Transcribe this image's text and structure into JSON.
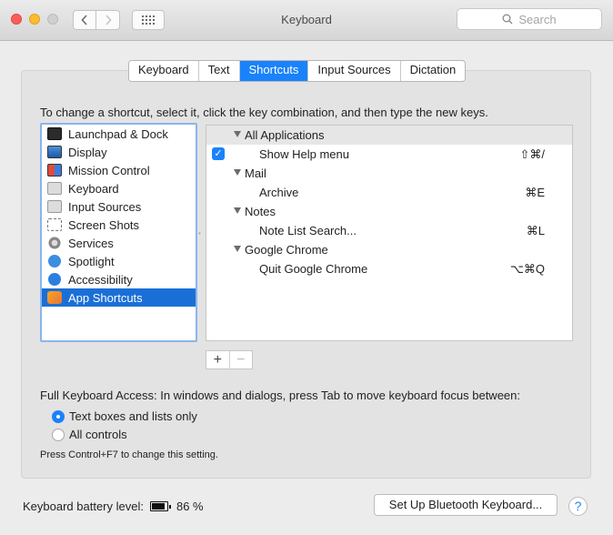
{
  "window": {
    "title": "Keyboard"
  },
  "search": {
    "placeholder": "Search"
  },
  "tabs": [
    {
      "label": "Keyboard",
      "active": false
    },
    {
      "label": "Text",
      "active": false
    },
    {
      "label": "Shortcuts",
      "active": true
    },
    {
      "label": "Input Sources",
      "active": false
    },
    {
      "label": "Dictation",
      "active": false
    }
  ],
  "instructions": "To change a shortcut, select it, click the key combination, and then type the new keys.",
  "categories": [
    {
      "label": "Launchpad & Dock",
      "icon": "launchpad-icon"
    },
    {
      "label": "Display",
      "icon": "display-icon"
    },
    {
      "label": "Mission Control",
      "icon": "mission-control-icon"
    },
    {
      "label": "Keyboard",
      "icon": "keyboard-icon"
    },
    {
      "label": "Input Sources",
      "icon": "input-sources-icon"
    },
    {
      "label": "Screen Shots",
      "icon": "screenshot-icon"
    },
    {
      "label": "Services",
      "icon": "gear-icon"
    },
    {
      "label": "Spotlight",
      "icon": "spotlight-icon"
    },
    {
      "label": "Accessibility",
      "icon": "accessibility-icon"
    },
    {
      "label": "App Shortcuts",
      "icon": "app-shortcuts-icon",
      "selected": true
    }
  ],
  "shortcuts": {
    "groups": [
      {
        "name": "All Applications",
        "items": [
          {
            "label": "Show Help menu",
            "keys": "⇧⌘/",
            "checked": true
          }
        ]
      },
      {
        "name": "Mail",
        "items": [
          {
            "label": "Archive",
            "keys": "⌘E"
          }
        ]
      },
      {
        "name": "Notes",
        "items": [
          {
            "label": "Note List Search...",
            "keys": "⌘L"
          }
        ]
      },
      {
        "name": "Google Chrome",
        "items": [
          {
            "label": "Quit Google Chrome",
            "keys": "⌥⌘Q"
          }
        ]
      }
    ]
  },
  "buttons": {
    "add": "+",
    "remove": "−"
  },
  "full_keyboard_access": {
    "label": "Full Keyboard Access: In windows and dialogs, press Tab to move keyboard focus between:",
    "options": [
      {
        "label": "Text boxes and lists only",
        "selected": true
      },
      {
        "label": "All controls",
        "selected": false
      }
    ],
    "hint": "Press Control+F7 to change this setting."
  },
  "battery": {
    "label": "Keyboard battery level:",
    "value": "86 %",
    "level": 0.86
  },
  "bluetooth_button": "Set Up Bluetooth Keyboard...",
  "help": "?",
  "colors": {
    "accent": "#1a82fb",
    "selection": "#1a6fd7"
  }
}
